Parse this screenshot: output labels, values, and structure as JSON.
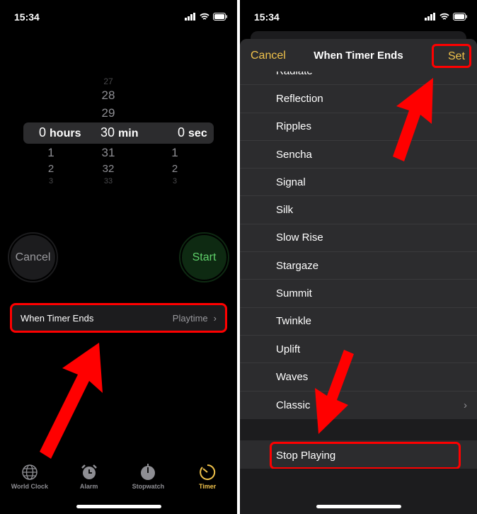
{
  "status_bar": {
    "time": "15:34"
  },
  "left": {
    "picker": {
      "hours": {
        "above": [],
        "selected": "0",
        "unit": "hours",
        "below": [
          "1",
          "2",
          "3"
        ]
      },
      "minutes": {
        "above": [
          "27",
          "28",
          "29"
        ],
        "selected": "30",
        "unit": "min",
        "below": [
          "31",
          "32",
          "33"
        ]
      },
      "seconds": {
        "above": [],
        "selected": "0",
        "unit": "sec",
        "below": [
          "1",
          "2",
          "3"
        ]
      }
    },
    "cancel_label": "Cancel",
    "start_label": "Start",
    "when_timer_ends": {
      "label": "When Timer Ends",
      "value": "Playtime"
    },
    "tabs": [
      {
        "label": "World Clock",
        "icon": "globe-icon",
        "active": false
      },
      {
        "label": "Alarm",
        "icon": "alarm-clock-icon",
        "active": false
      },
      {
        "label": "Stopwatch",
        "icon": "stopwatch-icon",
        "active": false
      },
      {
        "label": "Timer",
        "icon": "timer-icon",
        "active": true
      }
    ]
  },
  "right": {
    "header": {
      "cancel": "Cancel",
      "title": "When Timer Ends",
      "set": "Set"
    },
    "sounds": [
      "Radiate",
      "Reflection",
      "Ripples",
      "Sencha",
      "Signal",
      "Silk",
      "Slow Rise",
      "Stargaze",
      "Summit",
      "Twinkle",
      "Uplift",
      "Waves",
      "Classic"
    ],
    "stop_playing": "Stop Playing"
  },
  "colors": {
    "accent": "#f0c24b",
    "start_green": "#5fd06a",
    "highlight": "#ff0000"
  }
}
